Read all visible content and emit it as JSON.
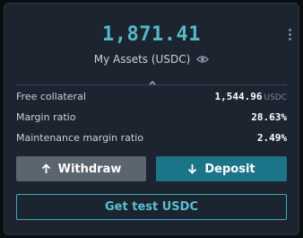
{
  "balance": "1,871.41",
  "assets_label": "My Assets (USDC)",
  "rows": [
    {
      "label": "Free collateral",
      "value": "1,544.96",
      "unit": "USDC"
    },
    {
      "label": "Margin ratio",
      "value": "28.63%",
      "unit": ""
    },
    {
      "label": "Maintenance margin ratio",
      "value": "2.49%",
      "unit": ""
    }
  ],
  "buttons": {
    "withdraw": "Withdraw",
    "deposit": "Deposit",
    "test_usdc": "Get test USDC"
  },
  "colors": {
    "accent": "#56b8c8",
    "deposit_bg": "#1b7488",
    "withdraw_bg": "#5a6570",
    "card_bg": "#1c2430"
  },
  "icons": [
    "kebab-menu-icon",
    "eye-icon",
    "chevron-up-icon",
    "arrow-up-icon",
    "arrow-down-icon"
  ]
}
